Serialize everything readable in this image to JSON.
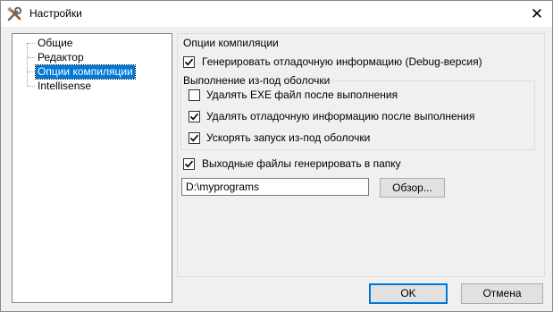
{
  "window": {
    "title": "Настройки",
    "close_symbol": "✕"
  },
  "icons": {
    "app": "tools-icon",
    "close": "close-icon",
    "check": "checkmark-icon"
  },
  "tree": {
    "items": [
      "Общие",
      "Редактор",
      "Опции компиляции",
      "Intellisense"
    ],
    "selected_index": 2
  },
  "compile_options": {
    "group_label": "Опции компиляции",
    "debug_info": {
      "label": "Генерировать отладочную информацию (Debug-версия)",
      "checked": true
    },
    "shell_group": {
      "label": "Выполнение из-под оболочки",
      "delete_exe": {
        "label": "Удалять EXE файл после выполнения",
        "checked": false
      },
      "delete_debug": {
        "label": "Удалять отладочную информацию после выполнения",
        "checked": true
      },
      "speed_up": {
        "label": "Ускорять запуск из-под оболочки",
        "checked": true
      }
    },
    "output_folder": {
      "label": "Выходные файлы генерировать в папку",
      "checked": true
    },
    "path_value": "D:\\myprograms",
    "browse_label": "Обзор..."
  },
  "buttons": {
    "ok": "OK",
    "cancel": "Отмена"
  },
  "colors": {
    "selection": "#0078d7",
    "window_bg": "#f0f0f0"
  }
}
